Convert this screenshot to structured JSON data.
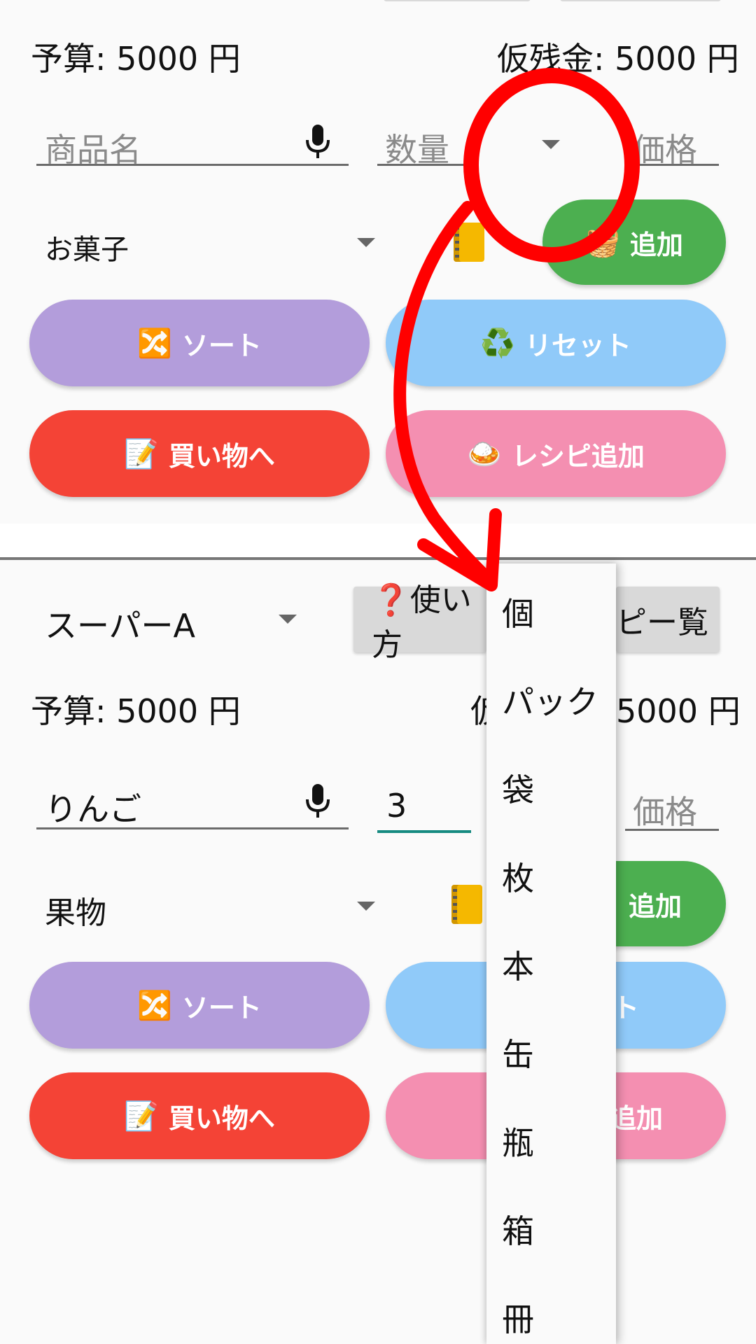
{
  "top": {
    "budget_text": "予算: 5000 円",
    "remaining_text": "仮残金: 5000 円",
    "item_placeholder": "商品名",
    "qty_placeholder": "数量",
    "price_placeholder": "価格",
    "category_value": "お菓子",
    "add_emoji": "🧺",
    "add_label": "追加",
    "sort_emoji": "🔀",
    "sort_label": "ソート",
    "reset_emoji": "♻️",
    "reset_label": "リセット",
    "shopping_emoji": "📝",
    "shopping_label": "買い物へ",
    "recipe_emoji": "🍛",
    "recipe_label": "レシピ追加"
  },
  "bottom": {
    "store_value": "スーパーA",
    "help_label": "❓使い方",
    "recipe_list_label": "ピー覧",
    "budget_text": "予算: 5000 円",
    "remaining_prefix": "仮",
    "remaining_suffix": "5000 円",
    "item_value": "りんご",
    "qty_value": "3",
    "price_placeholder": "価格",
    "category_value": "果物",
    "add_label": "追加",
    "sort_emoji": "🔀",
    "sort_label": "ソート",
    "reset_fragment": "ト",
    "shopping_emoji": "📝",
    "shopping_label": "買い物へ",
    "recipe_fragment": "追加"
  },
  "unit_dropdown": {
    "options": [
      "個",
      "パック",
      "袋",
      "枚",
      "本",
      "缶",
      "瓶",
      "箱",
      "冊"
    ]
  },
  "colors": {
    "purple": "#b39ddb",
    "blue": "#90caf9",
    "red": "#f44336",
    "pink": "#f48fb1",
    "green": "#4caf50",
    "annotation": "#ff0000"
  }
}
